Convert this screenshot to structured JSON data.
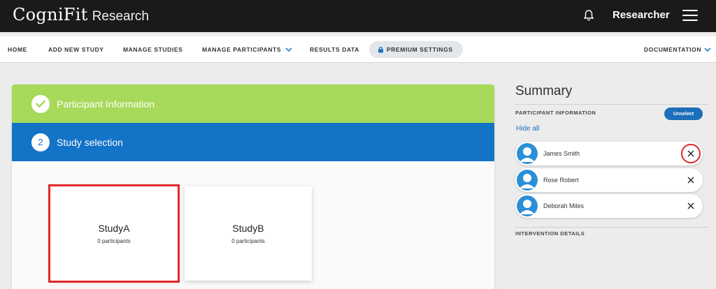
{
  "header": {
    "brand": "CogniFit",
    "product": "Research",
    "role": "Researcher",
    "icons": [
      "bell-icon",
      "hamburger-menu-icon"
    ]
  },
  "nav": {
    "items": [
      {
        "label": "HOME"
      },
      {
        "label": "ADD NEW STUDY"
      },
      {
        "label": "MANAGE STUDIES"
      },
      {
        "label": "MANAGE PARTICIPANTS",
        "dropdown": true
      },
      {
        "label": "RESULTS DATA"
      },
      {
        "label": "PREMIUM SETTINGS",
        "icon": "lock-icon"
      }
    ],
    "documentation": "DOCUMENTATION"
  },
  "steps": {
    "done": {
      "title": "Participant Information"
    },
    "active": {
      "number": "2",
      "title": "Study selection"
    }
  },
  "studies": [
    {
      "name": "StudyA",
      "count": "0 participants",
      "selected": true
    },
    {
      "name": "StudyB",
      "count": "0 participants",
      "selected": false
    }
  ],
  "summary": {
    "title": "Summary",
    "participant_section": "PARTICIPANT INFORMATION",
    "unselect": "Unselect",
    "hide_all": "Hide all",
    "participants": [
      {
        "name": "James Smith"
      },
      {
        "name": "Rose Robert"
      },
      {
        "name": "Deborah Miles"
      }
    ],
    "intervention_section": "INTERVENTION DETAILS"
  },
  "colors": {
    "topbar": "#1a1a1a",
    "step_done": "#a7d95a",
    "step_active": "#1273c7",
    "accent": "#1c6fb8",
    "highlight": "#e02828"
  }
}
